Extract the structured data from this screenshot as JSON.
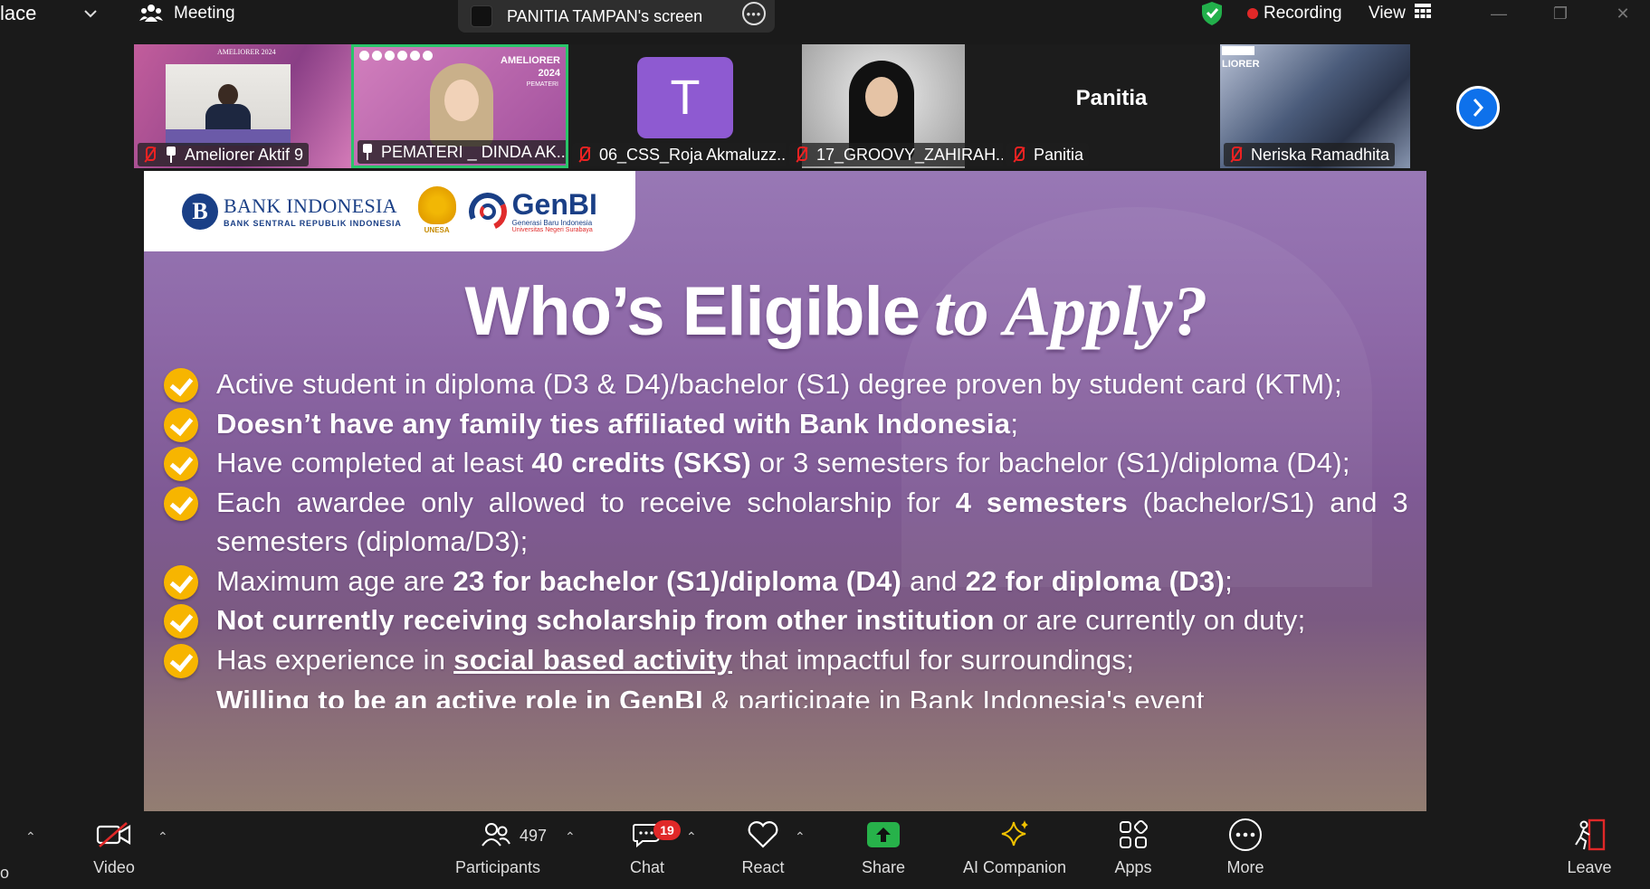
{
  "topbar": {
    "app_name_fragment": "lace",
    "meeting_label": "Meeting",
    "share_label": "PANITIA TAMPAN's screen",
    "recording_label": "Recording",
    "view_label": "View"
  },
  "participants": [
    {
      "name": "Ameliorer Aktif 9",
      "icon": "pin-icon",
      "background": "#c25d9c"
    },
    {
      "name": "PEMATERI _ DINDA AK...",
      "icon": "pin-icon",
      "background": "#d27fbd"
    },
    {
      "name": "06_CSS_Roja Akmaluzz...",
      "icon": "mic-muted-icon",
      "avatar_letter": "T",
      "background": "#1c1c1c"
    },
    {
      "name": "17_GROOVY_ZAHIRAH...",
      "icon": "mic-muted-icon",
      "background": "#c8c8c8"
    },
    {
      "name": "Panitia",
      "icon": "mic-muted-icon",
      "center_label": "Panitia",
      "background": "#1c1c1c"
    },
    {
      "name": "Neriska Ramadhita",
      "icon": "mic-muted-icon",
      "background": "#5a6a86"
    }
  ],
  "tile_texts": {
    "ameliorer_top": "AMELIORER 2024",
    "pemateri_top": "AMELIORER 2024",
    "pemateri_sub": "PEMATERI",
    "neriska_top": "LIORER"
  },
  "slide": {
    "logos": {
      "bank_indonesia": "BANK INDONESIA",
      "bank_indonesia_sub": "BANK SENTRAL REPUBLIK INDONESIA",
      "unesa": "UNESA",
      "genbi": "GenBI",
      "genbi_sub1": "Generasi Baru Indonesia",
      "genbi_sub2": "Universitas Negeri Surabaya"
    },
    "title_part1": "Who’s Eligible",
    "title_part2": "to Apply?",
    "items": [
      {
        "pre": "Active student in diploma (D3 & D4)/bachelor (S1) degree proven by student card (KTM);"
      },
      {
        "bold": "Doesn’t have any family ties affiliated with Bank Indonesia",
        "post": ";"
      },
      {
        "pre": "Have completed at least ",
        "bold": "40 credits (SKS)",
        "post": " or 3 semesters for bachelor (S1)/diploma (D4);"
      },
      {
        "pre": "Each awardee only allowed to receive scholarship for ",
        "bold": "4 semesters",
        "post": " (bachelor/S1) and 3 semesters (diploma/D3);"
      },
      {
        "pre": "Maximum age are ",
        "bold": "23 for bachelor (S1)/diploma (D4)",
        "mid": " and ",
        "bold2": "22 for diploma (D3)",
        "post": ";"
      },
      {
        "bold": "Not currently receiving scholarship from other institution",
        "post": " or are currently on duty;"
      },
      {
        "pre": "Has experience in ",
        "underline": "social based activity",
        "post": " that impactful for surroundings;"
      },
      {
        "bold": "Willing to be an active role in GenBI",
        "post": " & participate in Bank Indonesia's event"
      }
    ]
  },
  "toolbar": {
    "video_label": "Video",
    "participants_label": "Participants",
    "participants_count": "497",
    "chat_label": "Chat",
    "chat_badge": "19",
    "react_label": "React",
    "share_label": "Share",
    "ai_label": "AI Companion",
    "apps_label": "Apps",
    "more_label": "More",
    "leave_label": "Leave",
    "left_fragment": "o"
  },
  "colors": {
    "accent_blue": "#0e71eb",
    "recording_red": "#e02828",
    "check_yellow": "#f7b500",
    "share_green": "#27b24a",
    "shield_green": "#22b04b"
  }
}
